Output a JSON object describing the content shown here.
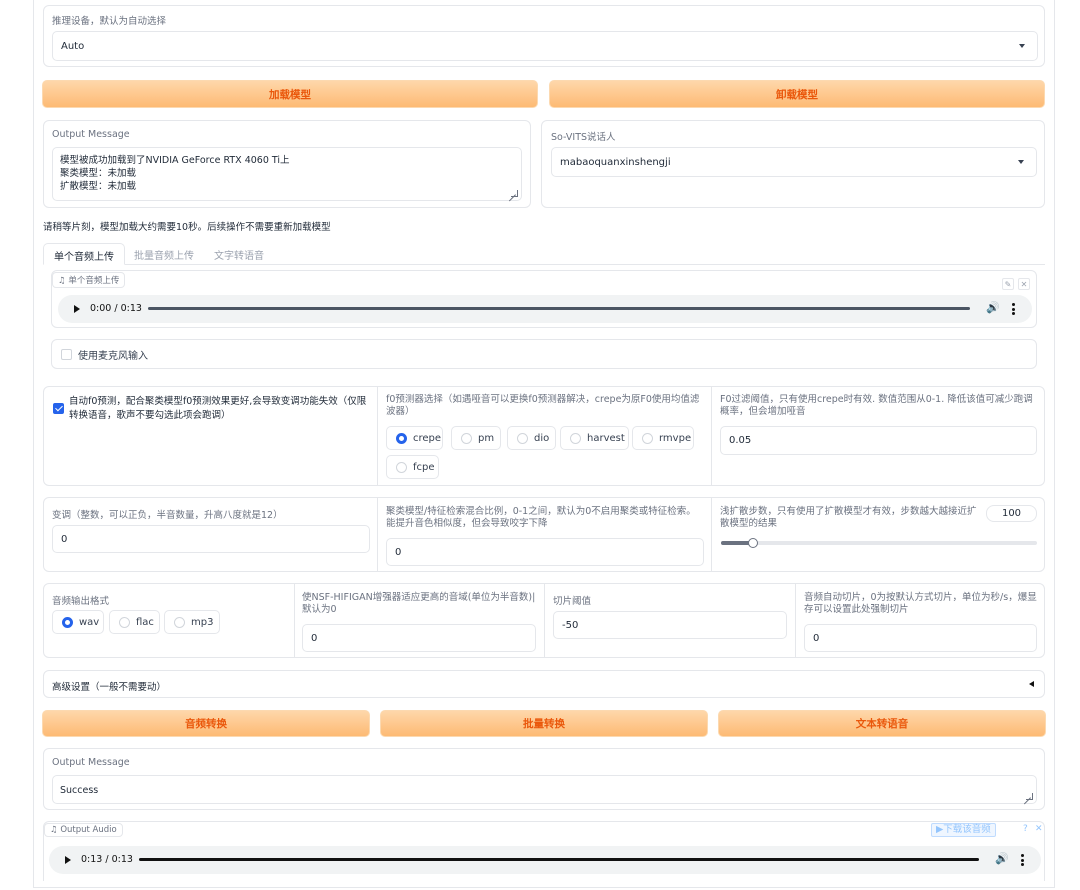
{
  "device": {
    "label": "推理设备，默认为自动选择",
    "value": "Auto"
  },
  "buttons": {
    "load_model": "加载模型",
    "unload_model": "卸载模型",
    "audio_convert": "音频转换",
    "batch_convert": "批量转换",
    "tts": "文本转语音"
  },
  "output_message_top": {
    "label": "Output Message",
    "lines": [
      "模型被成功加载到了NVIDIA GeForce RTX 4060 Ti上",
      "聚类模型：未加载",
      "扩散模型：未加载"
    ]
  },
  "speaker": {
    "label": "So-VITS说话人",
    "value": "mabaoquanxinshengji"
  },
  "notice": "请稍等片刻，模型加载大约需要10秒。后续操作不需要重新加载模型",
  "tabs": [
    "单个音频上传",
    "批量音频上传",
    "文字转语音"
  ],
  "upload": {
    "tag": "单个音频上传",
    "time": "0:00 / 0:13",
    "edit_icon": "✎",
    "close_icon": "✕"
  },
  "mic": {
    "label": "使用麦克风输入"
  },
  "auto_f0": {
    "label": "自动f0预测，配合聚类模型f0预测效果更好,会导致变调功能失效（仅限转换语音，歌声不要勾选此项会跑调）"
  },
  "f0_predictor": {
    "label": "f0预测器选择（如遇哑音可以更换f0预测器解决，crepe为原F0使用均值滤波器）",
    "options": [
      "crepe",
      "pm",
      "dio",
      "harvest",
      "rmvpe",
      "fcpe"
    ],
    "selected": "crepe"
  },
  "f0_filter": {
    "label": "F0过滤阈值，只有使用crepe时有效. 数值范围从0-1. 降低该值可减少跑调概率，但会增加哑音",
    "value": "0.05"
  },
  "transpose": {
    "label": "变调（整数，可以正负，半音数量，升高八度就是12）",
    "value": "0"
  },
  "cluster_ratio": {
    "label": "聚类模型/特征检索混合比例，0-1之间，默认为0不启用聚类或特征检索。能提升音色相似度，但会导致咬字下降",
    "value": "0"
  },
  "diffusion_steps": {
    "label": "浅扩散步数，只有使用了扩散模型才有效，步数越大越接近扩散模型的结果",
    "value": "100",
    "fraction": 0.1
  },
  "output_format": {
    "label": "音频输出格式",
    "options": [
      "wav",
      "flac",
      "mp3"
    ],
    "selected": "wav"
  },
  "nsf_hifigan": {
    "label": "使NSF-HIFIGAN增强器适应更高的音域(单位为半音数)|默认为0",
    "value": "0"
  },
  "slice_threshold": {
    "label": "切片阈值",
    "value": "-50"
  },
  "auto_slice": {
    "label": "音频自动切片，0为按默认方式切片，单位为秒/s，爆显存可以设置此处强制切片",
    "value": "0"
  },
  "advanced": {
    "label": "高级设置（一般不需要动）"
  },
  "output_message_bottom": {
    "label": "Output Message",
    "value": "Success"
  },
  "output_audio": {
    "tag": "Output Audio",
    "time": "0:13 / 0:13",
    "download": "▶下载该音频",
    "help": "?",
    "close": "✕"
  },
  "icons": {
    "music": "music-note-icon",
    "volume": "volume-icon",
    "more": "more-vertical-icon"
  }
}
